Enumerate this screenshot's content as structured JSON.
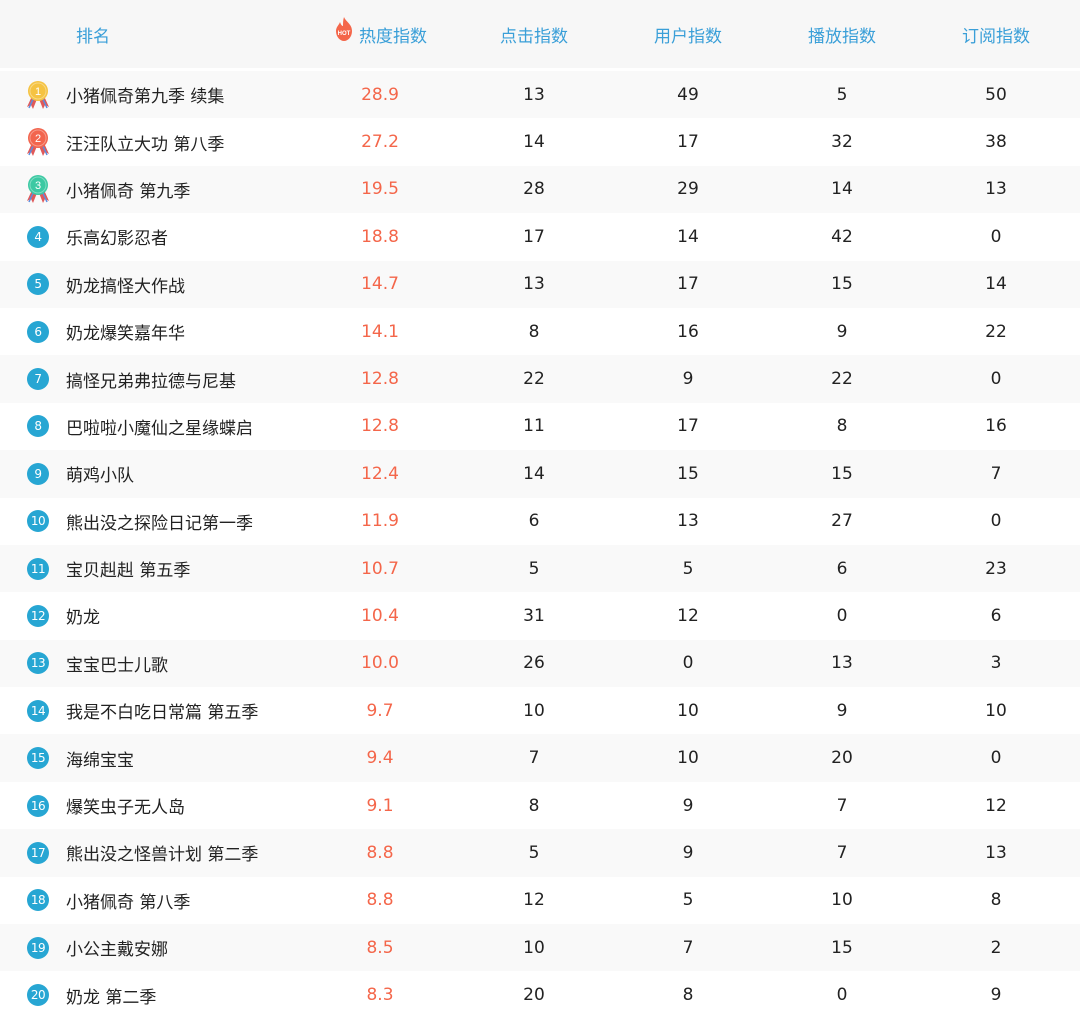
{
  "header": {
    "rank": "排名",
    "hot": "热度指数",
    "click": "点击指数",
    "user": "用户指数",
    "play": "播放指数",
    "subscribe": "订阅指数",
    "hot_icon_text": "HOT"
  },
  "colors": {
    "header_text": "#3a9fd8",
    "hot_value": "#f4664a",
    "badge": "#27a6d3",
    "gold": "#f5c342",
    "red": "#f2654e",
    "teal": "#3cc9a3"
  },
  "rows": [
    {
      "rank": "1",
      "title": "小猪佩奇第九季 续集",
      "hot": "28.9",
      "click": "13",
      "user": "49",
      "play": "5",
      "subscribe": "50"
    },
    {
      "rank": "2",
      "title": "汪汪队立大功 第八季",
      "hot": "27.2",
      "click": "14",
      "user": "17",
      "play": "32",
      "subscribe": "38"
    },
    {
      "rank": "3",
      "title": "小猪佩奇 第九季",
      "hot": "19.5",
      "click": "28",
      "user": "29",
      "play": "14",
      "subscribe": "13"
    },
    {
      "rank": "4",
      "title": "乐高幻影忍者",
      "hot": "18.8",
      "click": "17",
      "user": "14",
      "play": "42",
      "subscribe": "0"
    },
    {
      "rank": "5",
      "title": "奶龙搞怪大作战",
      "hot": "14.7",
      "click": "13",
      "user": "17",
      "play": "15",
      "subscribe": "14"
    },
    {
      "rank": "6",
      "title": "奶龙爆笑嘉年华",
      "hot": "14.1",
      "click": "8",
      "user": "16",
      "play": "9",
      "subscribe": "22"
    },
    {
      "rank": "7",
      "title": "搞怪兄弟弗拉德与尼基",
      "hot": "12.8",
      "click": "22",
      "user": "9",
      "play": "22",
      "subscribe": "0"
    },
    {
      "rank": "8",
      "title": "巴啦啦小魔仙之星缘蝶启",
      "hot": "12.8",
      "click": "11",
      "user": "17",
      "play": "8",
      "subscribe": "16"
    },
    {
      "rank": "9",
      "title": "萌鸡小队",
      "hot": "12.4",
      "click": "14",
      "user": "15",
      "play": "15",
      "subscribe": "7"
    },
    {
      "rank": "10",
      "title": "熊出没之探险日记第一季",
      "hot": "11.9",
      "click": "6",
      "user": "13",
      "play": "27",
      "subscribe": "0"
    },
    {
      "rank": "11",
      "title": "宝贝赳赳 第五季",
      "hot": "10.7",
      "click": "5",
      "user": "5",
      "play": "6",
      "subscribe": "23"
    },
    {
      "rank": "12",
      "title": "奶龙",
      "hot": "10.4",
      "click": "31",
      "user": "12",
      "play": "0",
      "subscribe": "6"
    },
    {
      "rank": "13",
      "title": "宝宝巴士儿歌",
      "hot": "10.0",
      "click": "26",
      "user": "0",
      "play": "13",
      "subscribe": "3"
    },
    {
      "rank": "14",
      "title": "我是不白吃日常篇 第五季",
      "hot": "9.7",
      "click": "10",
      "user": "10",
      "play": "9",
      "subscribe": "10"
    },
    {
      "rank": "15",
      "title": "海绵宝宝",
      "hot": "9.4",
      "click": "7",
      "user": "10",
      "play": "20",
      "subscribe": "0"
    },
    {
      "rank": "16",
      "title": "爆笑虫子无人岛",
      "hot": "9.1",
      "click": "8",
      "user": "9",
      "play": "7",
      "subscribe": "12"
    },
    {
      "rank": "17",
      "title": "熊出没之怪兽计划 第二季",
      "hot": "8.8",
      "click": "5",
      "user": "9",
      "play": "7",
      "subscribe": "13"
    },
    {
      "rank": "18",
      "title": "小猪佩奇 第八季",
      "hot": "8.8",
      "click": "12",
      "user": "5",
      "play": "10",
      "subscribe": "8"
    },
    {
      "rank": "19",
      "title": "小公主戴安娜",
      "hot": "8.5",
      "click": "10",
      "user": "7",
      "play": "15",
      "subscribe": "2"
    },
    {
      "rank": "20",
      "title": "奶龙 第二季",
      "hot": "8.3",
      "click": "20",
      "user": "8",
      "play": "0",
      "subscribe": "9"
    }
  ]
}
